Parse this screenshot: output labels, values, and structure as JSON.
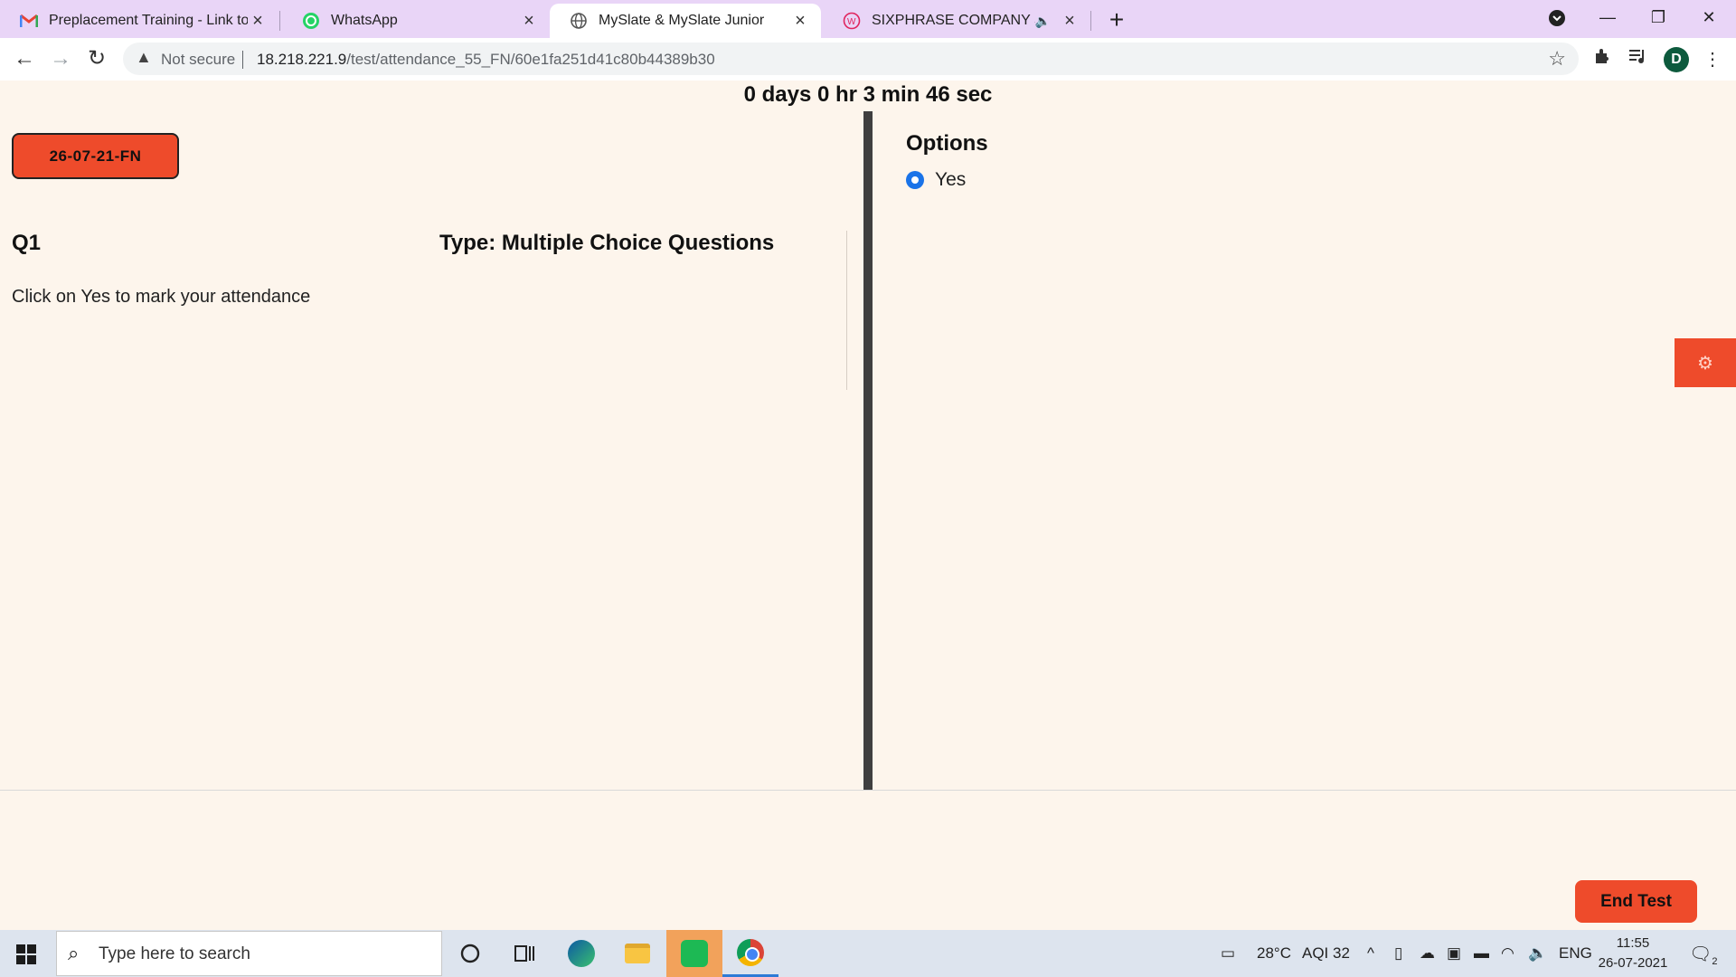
{
  "browser": {
    "tabs": [
      {
        "title": "Preplacement Training - Link to a",
        "icon": "gmail-icon",
        "active": false
      },
      {
        "title": "WhatsApp",
        "icon": "whatsapp-icon",
        "active": false
      },
      {
        "title": "MySlate & MySlate Junior",
        "icon": "globe-icon",
        "active": true
      },
      {
        "title": "SIXPHRASE COMPANY SPECI",
        "icon": "sixphrase-icon",
        "active": false
      }
    ],
    "address": {
      "security": "Not secure",
      "host": "18.218.221.9",
      "path": "/test/attendance_55_FN/60e1fa251d41c80b44389b30"
    },
    "profile_initial": "D"
  },
  "page": {
    "timer": "0 days 0 hr 3 min 46 sec",
    "session_label": "26-07-21-FN",
    "question": {
      "number": "Q1",
      "type": "Type: Multiple Choice Questions",
      "text": "Click on Yes to mark your attendance"
    },
    "options_title": "Options",
    "options": [
      {
        "label": "Yes",
        "selected": true
      }
    ],
    "end_test_label": "End Test",
    "accent_color": "#ee4b2b"
  },
  "taskbar": {
    "search_placeholder": "Type here to search",
    "weather": "28°C",
    "aqi": "AQI 32",
    "language": "ENG",
    "time": "11:55",
    "date": "26-07-2021",
    "notification_count": "2"
  }
}
